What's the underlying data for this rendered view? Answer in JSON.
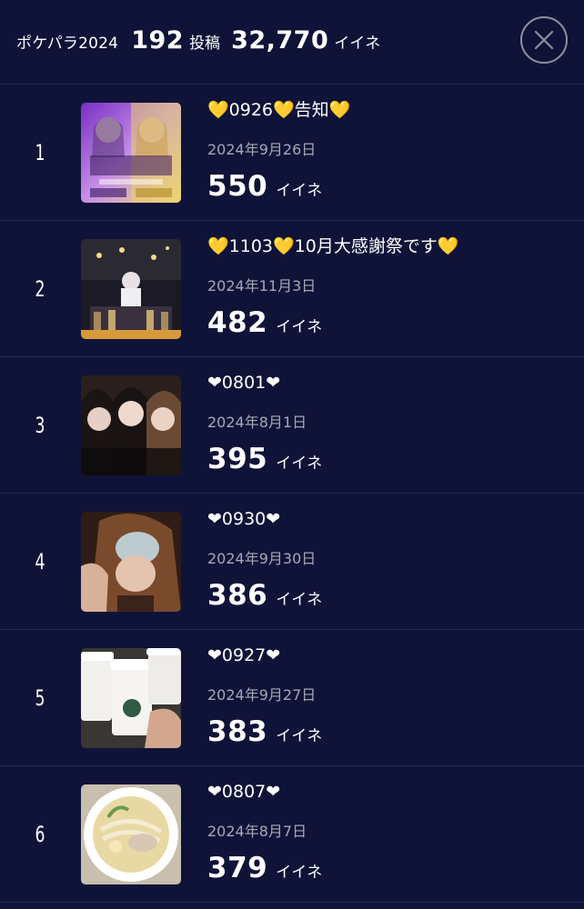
{
  "header": {
    "app_name": "ポケパラ2024",
    "posts_count": "192",
    "posts_unit": "投稿",
    "likes_total": "32,770",
    "likes_unit": "イイネ",
    "close_icon": "close-x-icon"
  },
  "posts": [
    {
      "rank": "1",
      "title": "💛0926💛告知💛",
      "date": "2024年9月26日",
      "likes": "550",
      "likes_unit": "イイネ",
      "thumbnail": "birthday-event-flyer-image"
    },
    {
      "rank": "2",
      "title": "💛1103💛10月大感謝祭です💛",
      "date": "2024年11月3日",
      "likes": "482",
      "likes_unit": "イイネ",
      "thumbnail": "champagne-tower-photo"
    },
    {
      "rank": "3",
      "title": "❤0801❤",
      "date": "2024年8月1日",
      "likes": "395",
      "likes_unit": "イイネ",
      "thumbnail": "three-girls-selfie-photo"
    },
    {
      "rank": "4",
      "title": "❤0930❤",
      "date": "2024年9月30日",
      "likes": "386",
      "likes_unit": "イイネ",
      "thumbnail": "selfie-photo"
    },
    {
      "rank": "5",
      "title": "❤0927❤",
      "date": "2024年9月27日",
      "likes": "383",
      "likes_unit": "イイネ",
      "thumbnail": "coffee-cups-photo"
    },
    {
      "rank": "6",
      "title": "❤0807❤",
      "date": "2024年8月7日",
      "likes": "379",
      "likes_unit": "イイネ",
      "thumbnail": "ramen-bowl-photo"
    }
  ]
}
